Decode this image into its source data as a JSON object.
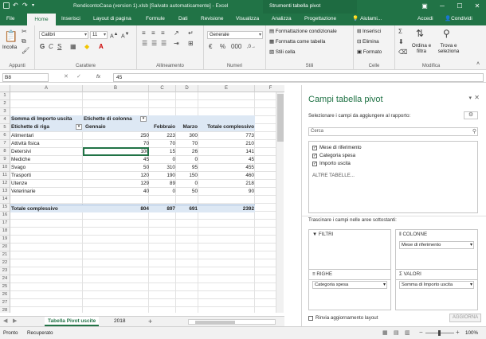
{
  "window": {
    "title": "RendicontoCasa (version 1).xlsb [Salvato automaticamente] - Excel",
    "context_tab_group": "Strumenti tabella pivot"
  },
  "tabs": [
    "File",
    "Home",
    "Inserisci",
    "Layout di pagina",
    "Formule",
    "Dati",
    "Revisione",
    "Visualizza",
    "Analizza",
    "Progettazione",
    "Aiutami...",
    "Accedi",
    "Condividi"
  ],
  "ribbon": {
    "clipboard": {
      "paste": "Incolla",
      "label": "Appunti"
    },
    "font": {
      "name": "Calibri",
      "size": "11",
      "label": "Carattere"
    },
    "alignment": {
      "label": "Allineamento"
    },
    "number": {
      "format": "Generale",
      "label": "Numeri"
    },
    "styles": {
      "cond_format": "Formattazione condizionale",
      "table_format": "Formatta come tabella",
      "cell_styles": "Stili cella",
      "label": "Stili"
    },
    "cells": {
      "insert": "Inserisci",
      "delete": "Elimina",
      "format": "Formato",
      "label": "Celle"
    },
    "editing": {
      "sort": "Ordina e filtra",
      "find": "Trova e seleziona",
      "label": "Modifica"
    }
  },
  "formula_bar": {
    "name_box": "B8",
    "formula": "45",
    "fx": "fx"
  },
  "grid": {
    "columns": [
      "A",
      "B",
      "C",
      "D",
      "E",
      "F"
    ],
    "rows": [
      "1",
      "2",
      "3",
      "4",
      "5",
      "6",
      "7",
      "8",
      "9",
      "10",
      "11",
      "12",
      "13",
      "14",
      "15",
      "16",
      "17",
      "18",
      "19",
      "20",
      "21",
      "22",
      "23",
      "24",
      "25",
      "26",
      "27",
      "28"
    ],
    "pivot": {
      "corner": "Somma di Importo uscita",
      "col_label": "Etichette di colonna",
      "row_label": "Etichette di riga",
      "months": [
        "Gennaio",
        "Febbraio",
        "Marzo"
      ],
      "total_header": "Totale complessivo",
      "body": [
        {
          "label": "Alimentari",
          "vals": [
            "250",
            "223",
            "300",
            "773"
          ]
        },
        {
          "label": "Attività fisica",
          "vals": [
            "70",
            "70",
            "70",
            "210"
          ]
        },
        {
          "label": "Detersivi",
          "vals": [
            "100",
            "15",
            "26",
            "141"
          ]
        },
        {
          "label": "Mediche",
          "vals": [
            "45",
            "0",
            "0",
            "45"
          ]
        },
        {
          "label": "Svago",
          "vals": [
            "50",
            "310",
            "95",
            "455"
          ]
        },
        {
          "label": "Trasporti",
          "vals": [
            "120",
            "190",
            "150",
            "460"
          ]
        },
        {
          "label": "Utenze",
          "vals": [
            "129",
            "89",
            "0",
            "218"
          ]
        },
        {
          "label": "Veterinarie",
          "vals": [
            "40",
            "0",
            "50",
            "90"
          ]
        }
      ],
      "grand": {
        "label": "Totale complessivo",
        "vals": [
          "804",
          "897",
          "691",
          "2392"
        ]
      }
    }
  },
  "sheets": {
    "tabs": [
      "Tabella Pivot uscite",
      "2018"
    ],
    "add": "+"
  },
  "pane": {
    "title": "Campi tabella pivot",
    "choose_text": "Selezionare i campi da aggiungere al rapporto:",
    "search_placeholder": "Cerca",
    "fields": [
      {
        "name": "Mese di riferimento",
        "checked": true
      },
      {
        "name": "Categoria spesa",
        "checked": true
      },
      {
        "name": "Importo uscita",
        "checked": true
      }
    ],
    "more_tables": "ALTRE TABELLE...",
    "drag_text": "Trascinare i campi nelle aree sottostanti:",
    "areas": {
      "filters": {
        "title": "FILTRI"
      },
      "columns": {
        "title": "COLONNE",
        "item": "Mese di riferimento"
      },
      "rows": {
        "title": "RIGHE",
        "item": "Categoria spesa"
      },
      "values": {
        "title": "VALORI",
        "item": "Somma di Importo uscita"
      }
    },
    "defer": "Rinvia aggiornamento layout",
    "update": "AGGIORNA"
  },
  "status": {
    "left": "Pronto",
    "recovered": "Recuperato",
    "zoom": "100%"
  }
}
